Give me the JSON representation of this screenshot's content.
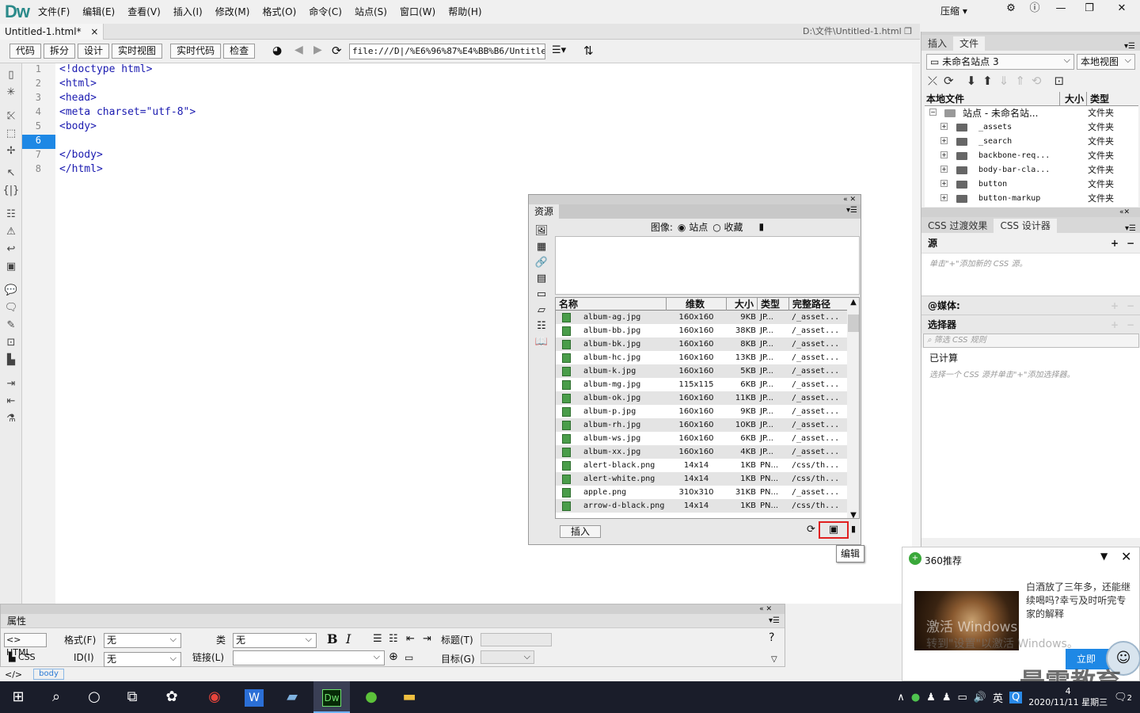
{
  "app": {
    "logo": "Dw",
    "menus": [
      "文件(F)",
      "编辑(E)",
      "查看(V)",
      "插入(I)",
      "修改(M)",
      "格式(O)",
      "命令(C)",
      "站点(S)",
      "窗口(W)",
      "帮助(H)"
    ],
    "compress": "压缩"
  },
  "doc": {
    "tab": "Untitled-1.html*",
    "path": "D:\\文件\\Untitled-1.html"
  },
  "toolbar": {
    "code": "代码",
    "split": "拆分",
    "design": "设计",
    "live": "实时视图",
    "livecode": "实时代码",
    "inspect": "检查",
    "url": "file:///D|/%E6%96%87%E4%BB%B6/Untitled"
  },
  "code": {
    "lines": [
      "1",
      "2",
      "3",
      "4",
      "5",
      "6",
      "7",
      "8"
    ],
    "current": "6",
    "text": [
      "<!doctype html>",
      "<html>",
      "<head>",
      "<meta charset=\"utf-8\">",
      "<body>",
      "",
      "</body>",
      "</html>"
    ]
  },
  "files": {
    "tabs": [
      "插入",
      "文件"
    ],
    "site": "未命名站点 3",
    "view": "本地视图",
    "headers": [
      "本地文件",
      "大小",
      "类型"
    ],
    "root": {
      "name": "站点 - 未命名站...",
      "type": "文件夹"
    },
    "items": [
      {
        "name": "_assets",
        "type": "文件夹"
      },
      {
        "name": "_search",
        "type": "文件夹"
      },
      {
        "name": "backbone-req...",
        "type": "文件夹"
      },
      {
        "name": "body-bar-cla...",
        "type": "文件夹"
      },
      {
        "name": "button",
        "type": "文件夹"
      },
      {
        "name": "button-markup",
        "type": "文件夹"
      }
    ]
  },
  "css": {
    "tabs": [
      "CSS 过渡效果",
      "CSS 设计器"
    ],
    "source": "源",
    "source_hint": "单击\"+\"添加新的 CSS 源。",
    "media": "@媒体:",
    "selector": "选择器",
    "filter": "筛选 CSS 规则",
    "computed": "已计算",
    "computed_hint": "选择一个 CSS 源并单击\"+\"添加选择器。"
  },
  "assets": {
    "title": "资源",
    "image_label": "图像:",
    "site": "站点",
    "favorites": "收藏",
    "headers": [
      "名称",
      "维数",
      "大小",
      "类型",
      "完整路径"
    ],
    "rows": [
      {
        "name": "album-ag.jpg",
        "dim": "160x160",
        "size": "9KB",
        "type": "JP...",
        "path": "/_asset..."
      },
      {
        "name": "album-bb.jpg",
        "dim": "160x160",
        "size": "38KB",
        "type": "JP...",
        "path": "/_asset..."
      },
      {
        "name": "album-bk.jpg",
        "dim": "160x160",
        "size": "8KB",
        "type": "JP...",
        "path": "/_asset..."
      },
      {
        "name": "album-hc.jpg",
        "dim": "160x160",
        "size": "13KB",
        "type": "JP...",
        "path": "/_asset..."
      },
      {
        "name": "album-k.jpg",
        "dim": "160x160",
        "size": "5KB",
        "type": "JP...",
        "path": "/_asset..."
      },
      {
        "name": "album-mg.jpg",
        "dim": "115x115",
        "size": "6KB",
        "type": "JP...",
        "path": "/_asset..."
      },
      {
        "name": "album-ok.jpg",
        "dim": "160x160",
        "size": "11KB",
        "type": "JP...",
        "path": "/_asset..."
      },
      {
        "name": "album-p.jpg",
        "dim": "160x160",
        "size": "9KB",
        "type": "JP...",
        "path": "/_asset..."
      },
      {
        "name": "album-rh.jpg",
        "dim": "160x160",
        "size": "10KB",
        "type": "JP...",
        "path": "/_asset..."
      },
      {
        "name": "album-ws.jpg",
        "dim": "160x160",
        "size": "6KB",
        "type": "JP...",
        "path": "/_asset..."
      },
      {
        "name": "album-xx.jpg",
        "dim": "160x160",
        "size": "4KB",
        "type": "JP...",
        "path": "/_asset..."
      },
      {
        "name": "alert-black.png",
        "dim": "14x14",
        "size": "1KB",
        "type": "PN...",
        "path": "/css/th..."
      },
      {
        "name": "alert-white.png",
        "dim": "14x14",
        "size": "1KB",
        "type": "PN...",
        "path": "/css/th..."
      },
      {
        "name": "apple.png",
        "dim": "310x310",
        "size": "31KB",
        "type": "PN...",
        "path": "/_asset..."
      },
      {
        "name": "arrow-d-black.png",
        "dim": "14x14",
        "size": "1KB",
        "type": "PN...",
        "path": "/css/th..."
      }
    ],
    "insert": "插入",
    "tooltip": "编辑"
  },
  "props": {
    "title": "属性",
    "html": "HTML",
    "css": "CSS",
    "format_label": "格式(F)",
    "format": "无",
    "class_label": "类",
    "class": "无",
    "id_label": "ID(I)",
    "id": "无",
    "link_label": "链接(L)",
    "heading_label": "标题(T)",
    "target_label": "目标(G)",
    "tag": "body"
  },
  "popup": {
    "title": "360推荐",
    "text": "白酒放了三年多，还能继续喝吗?幸亏及时听完专家的解释",
    "watermark1": "激活 Windows",
    "watermark2": "转到\"设置\"以激活 Windows。",
    "button": "立即"
  },
  "taskbar": {
    "time": "4",
    "date": "2020/11/11 星期三",
    "lang": "英",
    "notif": "2"
  },
  "brand": "最需教育"
}
